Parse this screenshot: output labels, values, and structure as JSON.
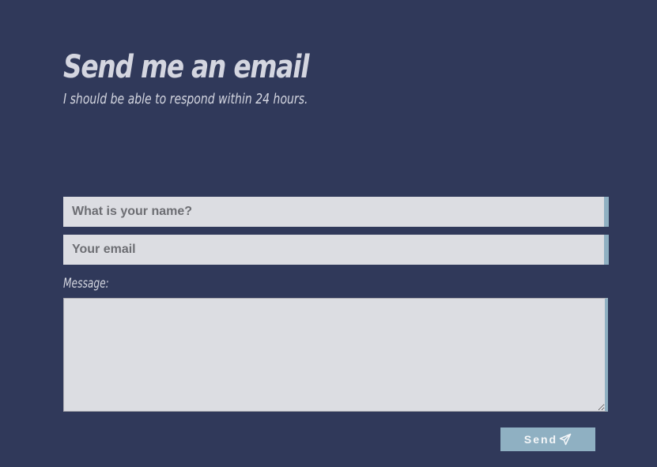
{
  "header": {
    "title": "Send me an email",
    "subtitle": "I should be able to respond within 24 hours."
  },
  "form": {
    "name_placeholder": "What is your name?",
    "email_placeholder": "Your email",
    "message_label": "Message:",
    "send_label": "Send",
    "send_icon": "paper-plane-icon"
  },
  "colors": {
    "background": "#30395a",
    "field_background": "#dcdde2",
    "accent": "#8fb0c2",
    "text_light": "#d4d6e0"
  }
}
